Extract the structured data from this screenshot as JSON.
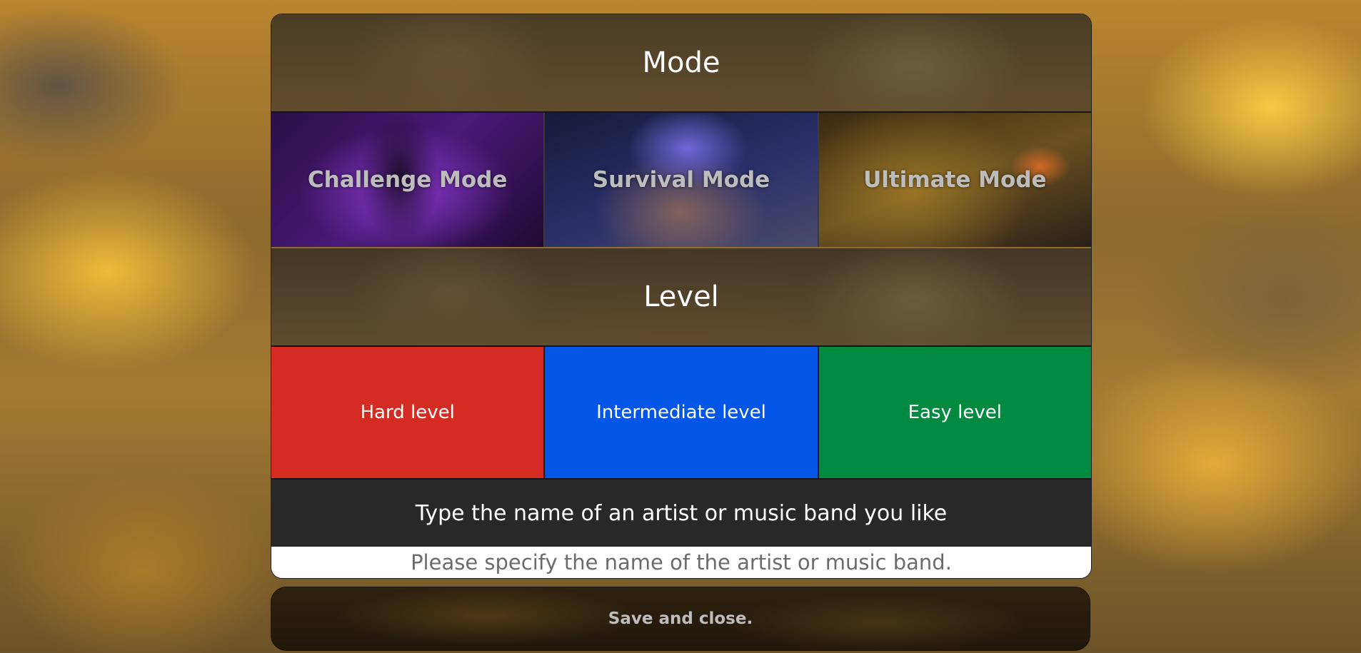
{
  "mode": {
    "title": "Mode",
    "options": [
      {
        "label": "Challenge Mode"
      },
      {
        "label": "Survival Mode"
      },
      {
        "label": "Ultimate Mode"
      }
    ]
  },
  "level": {
    "title": "Level",
    "options": [
      {
        "label": "Hard level",
        "color": "#d42b22"
      },
      {
        "label": "Intermediate level",
        "color": "#0456e6"
      },
      {
        "label": "Easy level",
        "color": "#028a41"
      }
    ]
  },
  "artist": {
    "prompt": "Type the name of an artist or music band you like",
    "placeholder": "Please specify the name of the artist or music band.",
    "value": ""
  },
  "actions": {
    "save_label": "Save and close."
  }
}
